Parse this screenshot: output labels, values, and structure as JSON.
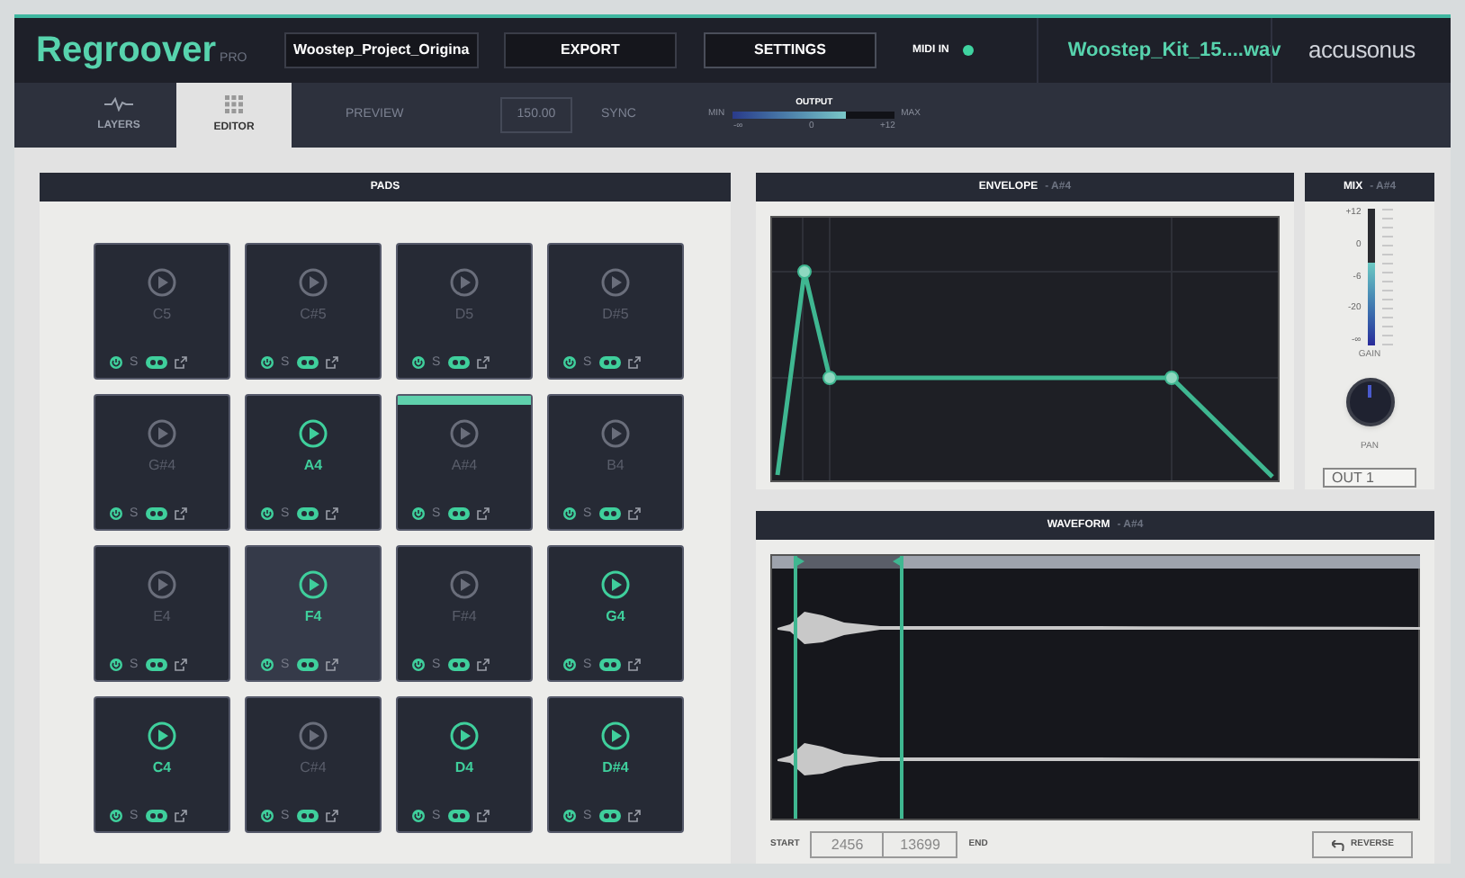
{
  "header": {
    "logo": "Regroover",
    "logo_badge": "PRO",
    "project": "Woostep_Project_Origina",
    "export": "EXPORT",
    "settings": "SETTINGS",
    "midi_in": {
      "label": "MIDI IN",
      "on": true
    },
    "file": "Woostep_Kit_15....wav",
    "brand": "accusonus"
  },
  "tabs": [
    {
      "label": "LAYERS",
      "selected": false
    },
    {
      "label": "EDITOR",
      "selected": true
    }
  ],
  "toolbar": {
    "preview": {
      "label": "PREVIEW",
      "disabled": true
    },
    "tempo": {
      "value": "150.00",
      "disabled": true
    },
    "sync": {
      "label": "SYNC",
      "disabled": true
    },
    "output": {
      "label": "OUTPUT",
      "min": "MIN",
      "max": "MAX",
      "ticks": [
        "-∞",
        "0",
        "+12"
      ],
      "level": 0.7
    }
  },
  "pads_panel": {
    "title": "PADS",
    "pads": [
      {
        "note": "C5",
        "solo": "S",
        "active": false,
        "selected": false,
        "playing": false
      },
      {
        "note": "C#5",
        "solo": "S",
        "active": false,
        "selected": false,
        "playing": false
      },
      {
        "note": "D5",
        "solo": "S",
        "active": false,
        "selected": false,
        "playing": false
      },
      {
        "note": "D#5",
        "solo": "S",
        "active": false,
        "selected": false,
        "playing": false
      },
      {
        "note": "G#4",
        "solo": "S",
        "active": false,
        "selected": false,
        "playing": false
      },
      {
        "note": "A4",
        "solo": "S",
        "active": true,
        "selected": false,
        "playing": false
      },
      {
        "note": "A#4",
        "solo": "S",
        "active": false,
        "selected": false,
        "playing": true
      },
      {
        "note": "B4",
        "solo": "S",
        "active": false,
        "selected": false,
        "playing": false
      },
      {
        "note": "E4",
        "solo": "S",
        "active": false,
        "selected": false,
        "playing": false
      },
      {
        "note": "F4",
        "solo": "S",
        "active": true,
        "selected": true,
        "playing": false
      },
      {
        "note": "F#4",
        "solo": "S",
        "active": false,
        "selected": false,
        "playing": false
      },
      {
        "note": "G4",
        "solo": "S",
        "active": true,
        "selected": false,
        "playing": false
      },
      {
        "note": "C4",
        "solo": "S",
        "active": true,
        "selected": false,
        "playing": false
      },
      {
        "note": "C#4",
        "solo": "S",
        "active": false,
        "selected": false,
        "playing": false
      },
      {
        "note": "D4",
        "solo": "S",
        "active": true,
        "selected": false,
        "playing": false
      },
      {
        "note": "D#4",
        "solo": "S",
        "active": true,
        "selected": false,
        "playing": false
      }
    ]
  },
  "envelope": {
    "title": "ENVELOPE",
    "pad": "- A#4"
  },
  "mix": {
    "title": "MIX",
    "pad": "- A#4",
    "gain_scale": [
      "+12",
      "0",
      "-6",
      "-20",
      "-∞"
    ],
    "gain_label": "GAIN",
    "gain": {
      "level": 0.6
    },
    "pan_label": "PAN",
    "output": "OUT 1"
  },
  "waveform": {
    "title": "WAVEFORM",
    "pad": "- A#4",
    "start_label": "START",
    "start": "2456",
    "end": "13699",
    "end_label": "END",
    "reverse": "REVERSE"
  }
}
